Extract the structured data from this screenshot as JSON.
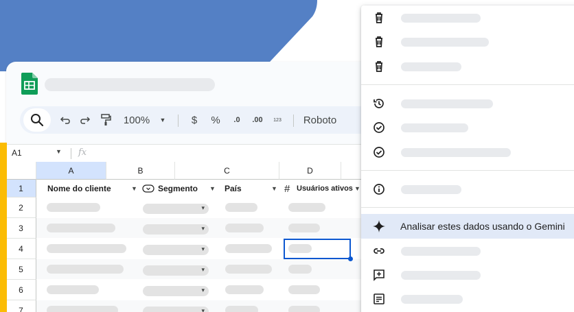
{
  "colors": {
    "accent_blue": "#5480c5",
    "sheets_green": "#0f9d58",
    "selection_blue": "#0b57d0",
    "highlight": "#e1e9f7",
    "yellow": "#fbbc04"
  },
  "toolbar": {
    "icons": [
      "search-icon",
      "undo-icon",
      "redo-icon",
      "paint-format-icon"
    ],
    "zoom": "100%",
    "currency": "$",
    "percent": "%",
    "decrease_decimal": ".0",
    "increase_decimal": ".00",
    "number_format": "123",
    "font": "Roboto"
  },
  "formula_bar": {
    "cell_ref": "A1",
    "fx": "fx"
  },
  "grid": {
    "columns": [
      "A",
      "B",
      "C",
      "D"
    ],
    "rows": [
      "1",
      "2",
      "3",
      "4",
      "5",
      "6",
      "7"
    ],
    "headers": {
      "customer_name": "Nome do cliente",
      "segment": "Segmento",
      "country": "País",
      "active_users": "Usuários ativos",
      "hash": "#"
    }
  },
  "context_menu": {
    "items": [
      {
        "icon": "trash-icon"
      },
      {
        "icon": "trash-icon"
      },
      {
        "icon": "trash-icon"
      },
      {
        "icon": "history-icon"
      },
      {
        "icon": "check-circle-icon"
      },
      {
        "icon": "check-circle-icon"
      },
      {
        "icon": "info-icon"
      },
      {
        "icon": "sparkle-icon",
        "label": "Analisar estes dados usando o Gemini"
      },
      {
        "icon": "link-icon"
      },
      {
        "icon": "add-comment-icon"
      },
      {
        "icon": "notes-icon"
      }
    ]
  }
}
